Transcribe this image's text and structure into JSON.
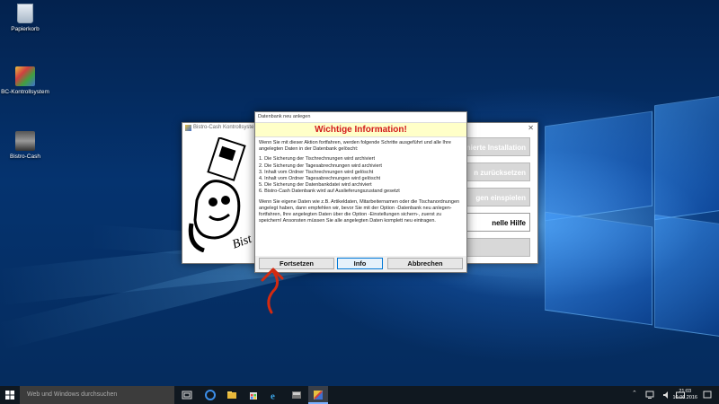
{
  "desktop": {
    "icons": [
      {
        "label": "Papierkorb"
      },
      {
        "label": "BC-Kontrollsystem"
      },
      {
        "label": "Bistro-Cash"
      }
    ]
  },
  "app_window": {
    "title": "Bistro-Cash Kontrollsyste",
    "buttons": [
      "nierte Installation",
      "n zurücksetzen",
      "gen einspielen",
      "nelle Hilfe",
      ""
    ]
  },
  "dialog": {
    "title": "Datenbank neu anlegen",
    "header": "Wichtige Information!",
    "intro": "Wenn Sie mit dieser Aktion fortfahren, werden folgende Schritte ausgeführt und alle Ihre angelegten Daten in der Datenbank gelöscht:",
    "steps": [
      "1. Die Sicherung der Tischrechnungen wird archiviert",
      "2. Die Sicherung der Tagesabrechnungen wird archiviert",
      "3. Inhalt vom Ordner Tischrechnungen wird gelöscht",
      "4. Inhalt vom Ordner Tagesabrechnungen wird gelöscht",
      "5. Die Sicherung der Datenbankdatei wird archiviert",
      "6. Bistro-Cash Datenbank wird auf Auslieferungszustand gesetzt"
    ],
    "note": "Wenn Sie eigene Daten wie z.B. Artikeldaten, Mitarbeiternamen oder die Tischanordnungen angelegt haben, dann empfehlen wir, bevor Sie mit der Option -Datenbank neu anlegen- fortfahren, Ihre angelegten Daten über die Option -Einstellungen sichern-, zuerst zu speichern! Ansonsten müssen Sie alle angelegten Daten komplett neu eintragen.",
    "buttons": {
      "continue": "Fortsetzen",
      "info": "Info",
      "cancel": "Abbrechen"
    }
  },
  "taskbar": {
    "search_placeholder": "Web und Windows durchsuchen",
    "time": "21:03",
    "date": "10.06.2016"
  },
  "colors": {
    "header_text": "#d21c1c",
    "header_bg": "#ffffc8",
    "annotation_arrow": "#d42a10"
  }
}
